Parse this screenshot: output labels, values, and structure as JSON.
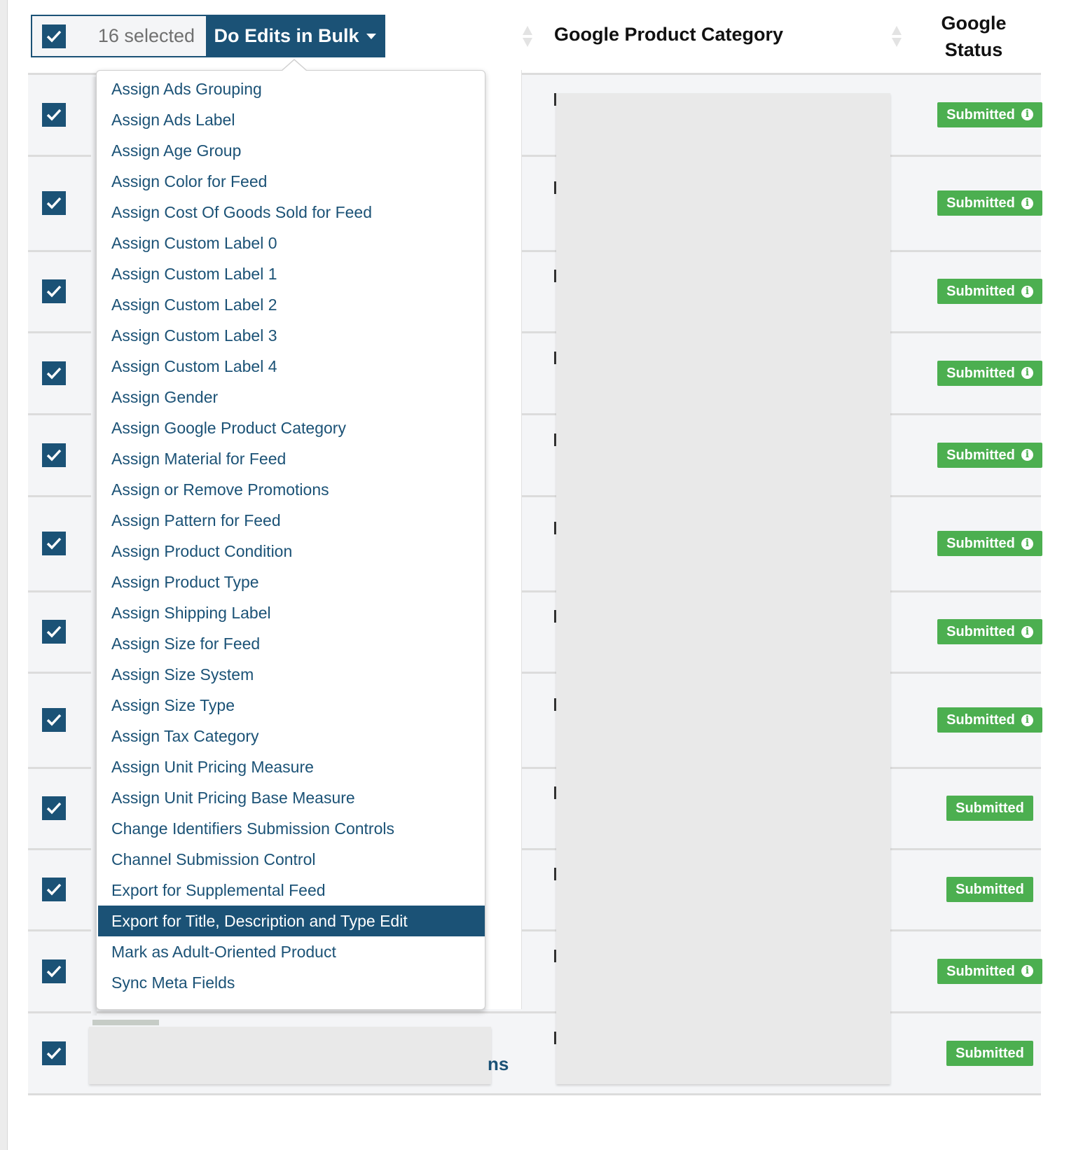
{
  "toolbar": {
    "select_all_checked": true,
    "selected_count_label": "16 selected",
    "bulk_button_label": "Do Edits in Bulk"
  },
  "columns": {
    "google_product_category": "Google Product Category",
    "google_status": "Google Status"
  },
  "dropdown": {
    "items": [
      {
        "label": "Assign Ads Grouping"
      },
      {
        "label": "Assign Ads Label"
      },
      {
        "label": "Assign Age Group"
      },
      {
        "label": "Assign Color for Feed"
      },
      {
        "label": "Assign Cost Of Goods Sold for Feed"
      },
      {
        "label": "Assign Custom Label 0"
      },
      {
        "label": "Assign Custom Label 1"
      },
      {
        "label": "Assign Custom Label 2"
      },
      {
        "label": "Assign Custom Label 3"
      },
      {
        "label": "Assign Custom Label 4"
      },
      {
        "label": "Assign Gender"
      },
      {
        "label": "Assign Google Product Category"
      },
      {
        "label": "Assign Material for Feed"
      },
      {
        "label": "Assign or Remove Promotions"
      },
      {
        "label": "Assign Pattern for Feed"
      },
      {
        "label": "Assign Product Condition"
      },
      {
        "label": "Assign Product Type"
      },
      {
        "label": "Assign Shipping Label"
      },
      {
        "label": "Assign Size for Feed"
      },
      {
        "label": "Assign Size System"
      },
      {
        "label": "Assign Size Type"
      },
      {
        "label": "Assign Tax Category"
      },
      {
        "label": "Assign Unit Pricing Measure"
      },
      {
        "label": "Assign Unit Pricing Base Measure"
      },
      {
        "label": "Change Identifiers Submission Controls"
      },
      {
        "label": "Channel Submission Control"
      },
      {
        "label": "Export for Supplemental Feed"
      },
      {
        "label": "Export for Title, Description and Type Edit",
        "highlighted": true
      },
      {
        "label": "Mark as Adult-Oriented Product"
      },
      {
        "label": "Sync Meta Fields"
      }
    ]
  },
  "rows": [
    {
      "checked": true,
      "status": "Submitted",
      "info": true
    },
    {
      "checked": true,
      "status": "Submitted",
      "info": true
    },
    {
      "checked": true,
      "status": "Submitted",
      "info": true
    },
    {
      "checked": true,
      "status": "Submitted",
      "info": true
    },
    {
      "checked": true,
      "status": "Submitted",
      "info": true
    },
    {
      "checked": true,
      "status": "Submitted",
      "info": true
    },
    {
      "checked": true,
      "status": "Submitted",
      "info": true
    },
    {
      "checked": true,
      "status": "Submitted",
      "info": true
    },
    {
      "checked": true,
      "status": "Submitted",
      "info": false
    },
    {
      "checked": true,
      "status": "Submitted",
      "info": false
    },
    {
      "checked": true,
      "status": "Submitted",
      "info": true
    },
    {
      "checked": true,
      "status": "Submitted",
      "info": false
    }
  ],
  "partial_title_text": "ns",
  "colors": {
    "primary": "#1b5276",
    "status_submitted": "#4caf50",
    "row_background": "#f4f5f7"
  }
}
